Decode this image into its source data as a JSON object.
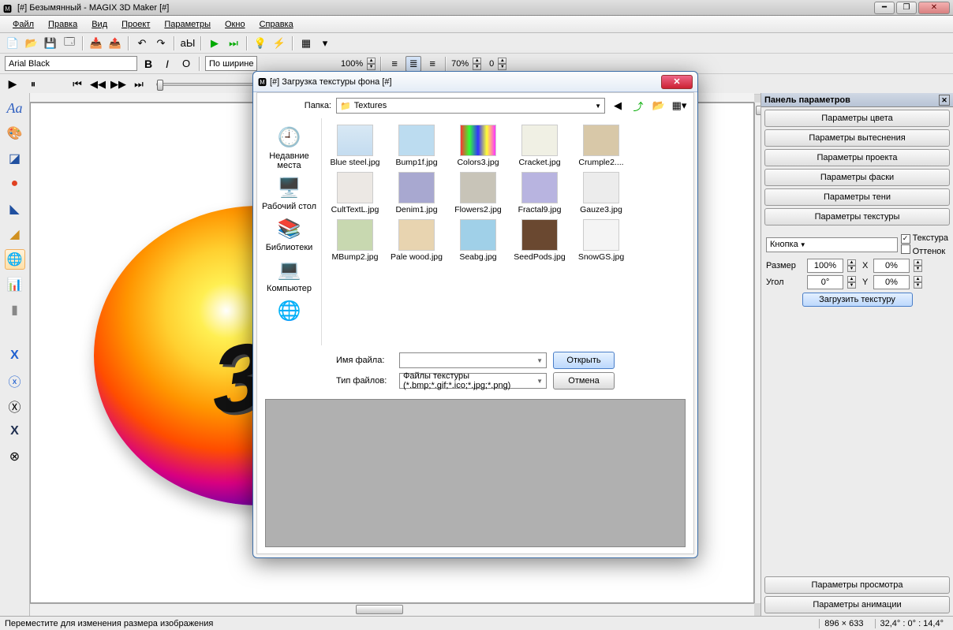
{
  "window": {
    "title": "[#] Безымянный - MAGIX 3D Maker [#]"
  },
  "menu": [
    "Файл",
    "Правка",
    "Вид",
    "Проект",
    "Параметры",
    "Окно",
    "Справка"
  ],
  "toolbar2": {
    "font": "Arial Black",
    "alignCombo": "По ширине",
    "zoom1": "100%",
    "zoom2": "70%",
    "zoom3": "0"
  },
  "rightpanel": {
    "title": "Панель параметров",
    "buttons": [
      "Параметры цвета",
      "Параметры вытеснения",
      "Параметры проекта",
      "Параметры фаски",
      "Параметры тени",
      "Параметры текстуры"
    ],
    "combo": "Кнопка",
    "chk_texture": "Текстура",
    "chk_tint": "Оттенок",
    "size_label": "Размер",
    "size_val": "100%",
    "size_x": "X",
    "size_xval": "0%",
    "angle_label": "Угол",
    "angle_val": "0°",
    "angle_y": "Y",
    "angle_yval": "0%",
    "load_btn": "Загрузить текстуру",
    "bottom1": "Параметры просмотра",
    "bottom2": "Параметры анимации"
  },
  "status": {
    "left": "Переместите для изменения размера изображения",
    "dims": "896 × 633",
    "angles": "32,4° : 0° : 14,4°"
  },
  "dialog": {
    "title": "[#] Загрузка текстуры фона [#]",
    "folder_label": "Папка:",
    "folder": "Textures",
    "places": [
      {
        "icon": "🕘",
        "label": "Недавние места"
      },
      {
        "icon": "🖥️",
        "label": "Рабочий стол"
      },
      {
        "icon": "📚",
        "label": "Библиотеки"
      },
      {
        "icon": "💻",
        "label": "Компьютер"
      },
      {
        "icon": "🌐",
        "label": ""
      }
    ],
    "files": [
      {
        "name": "Blue steel.jpg",
        "bg": "linear-gradient(#d8e8f4,#c4dcf0)"
      },
      {
        "name": "Bump1f.jpg",
        "bg": "#bcdcf0"
      },
      {
        "name": "Colors3.jpg",
        "bg": "linear-gradient(90deg,#f33,#3f3,#33f,#ff3,#f3f)"
      },
      {
        "name": "Cracket.jpg",
        "bg": "#f0f0e4"
      },
      {
        "name": "Crumple2....",
        "bg": "#d8c8a8"
      },
      {
        "name": "CultTextL.jpg",
        "bg": "#ece8e4"
      },
      {
        "name": "Denim1.jpg",
        "bg": "#a8a8d0"
      },
      {
        "name": "Flowers2.jpg",
        "bg": "#c8c4b8"
      },
      {
        "name": "Fractal9.jpg",
        "bg": "#b8b4e0"
      },
      {
        "name": "Gauze3.jpg",
        "bg": "#ececec"
      },
      {
        "name": "MBump2.jpg",
        "bg": "#c8d8b0"
      },
      {
        "name": "Pale wood.jpg",
        "bg": "#e8d4b0"
      },
      {
        "name": "Seabg.jpg",
        "bg": "#a0d0e8"
      },
      {
        "name": "SeedPods.jpg",
        "bg": "#6a4830"
      },
      {
        "name": "SnowGS.jpg",
        "bg": "#f4f4f4"
      }
    ],
    "fname_label": "Имя файла:",
    "ftype_label": "Тип файлов:",
    "ftype_value": "Файлы текстуры (*.bmp;*.gif;*.ico;*.jpg;*.png)",
    "open": "Открыть",
    "cancel": "Отмена"
  },
  "canvas_text": "3"
}
